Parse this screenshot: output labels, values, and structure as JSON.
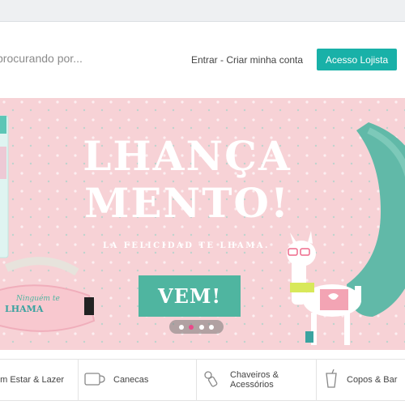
{
  "header": {
    "search_placeholder": "procurando por...",
    "login_text": "Entrar - Criar minha conta",
    "lojista_button": "Acesso Lojista"
  },
  "banner": {
    "title_line1": "LHANÇA",
    "title_line2": "MENTO!",
    "tagline": "LA FELICIDAD TE LHAMA.",
    "cta_label": "VEM!",
    "mask_text": "LHAMA",
    "mask_text_top": "Ninguém te",
    "pager": {
      "count": 4,
      "active_index": 1
    }
  },
  "categories": [
    {
      "label": "em Estar & Lazer",
      "icon": "none"
    },
    {
      "label": "Canecas",
      "icon": "mug-icon"
    },
    {
      "label_line1": "Chaveiros &",
      "label_line2": "Acessórios",
      "icon": "keychain-icon"
    },
    {
      "label": "Copos & Bar",
      "icon": "cup-icon"
    }
  ],
  "colors": {
    "accent": "#19b1a8",
    "banner_bg": "#f7d2d6",
    "cta_bg": "#4fb5a0",
    "pager_active": "#e94a8a"
  }
}
